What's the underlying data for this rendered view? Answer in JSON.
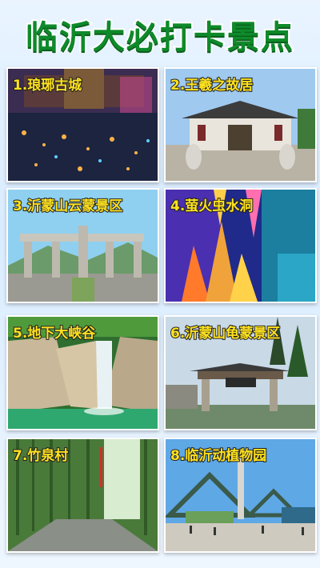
{
  "title": "临沂大必打卡景点",
  "spots": [
    {
      "label": "1.琅琊古城"
    },
    {
      "label": "2.王羲之故居"
    },
    {
      "label": "3.沂蒙山云蒙景区"
    },
    {
      "label": "4.萤火虫水洞"
    },
    {
      "label": "5.地下大峡谷"
    },
    {
      "label": "6.沂蒙山龟蒙景区"
    },
    {
      "label": "7.竹泉村"
    },
    {
      "label": "8.临沂动植物园"
    }
  ],
  "colors": {
    "title": "#0e8a2a",
    "label": "#ffe21f",
    "outline": "#ffffff"
  }
}
